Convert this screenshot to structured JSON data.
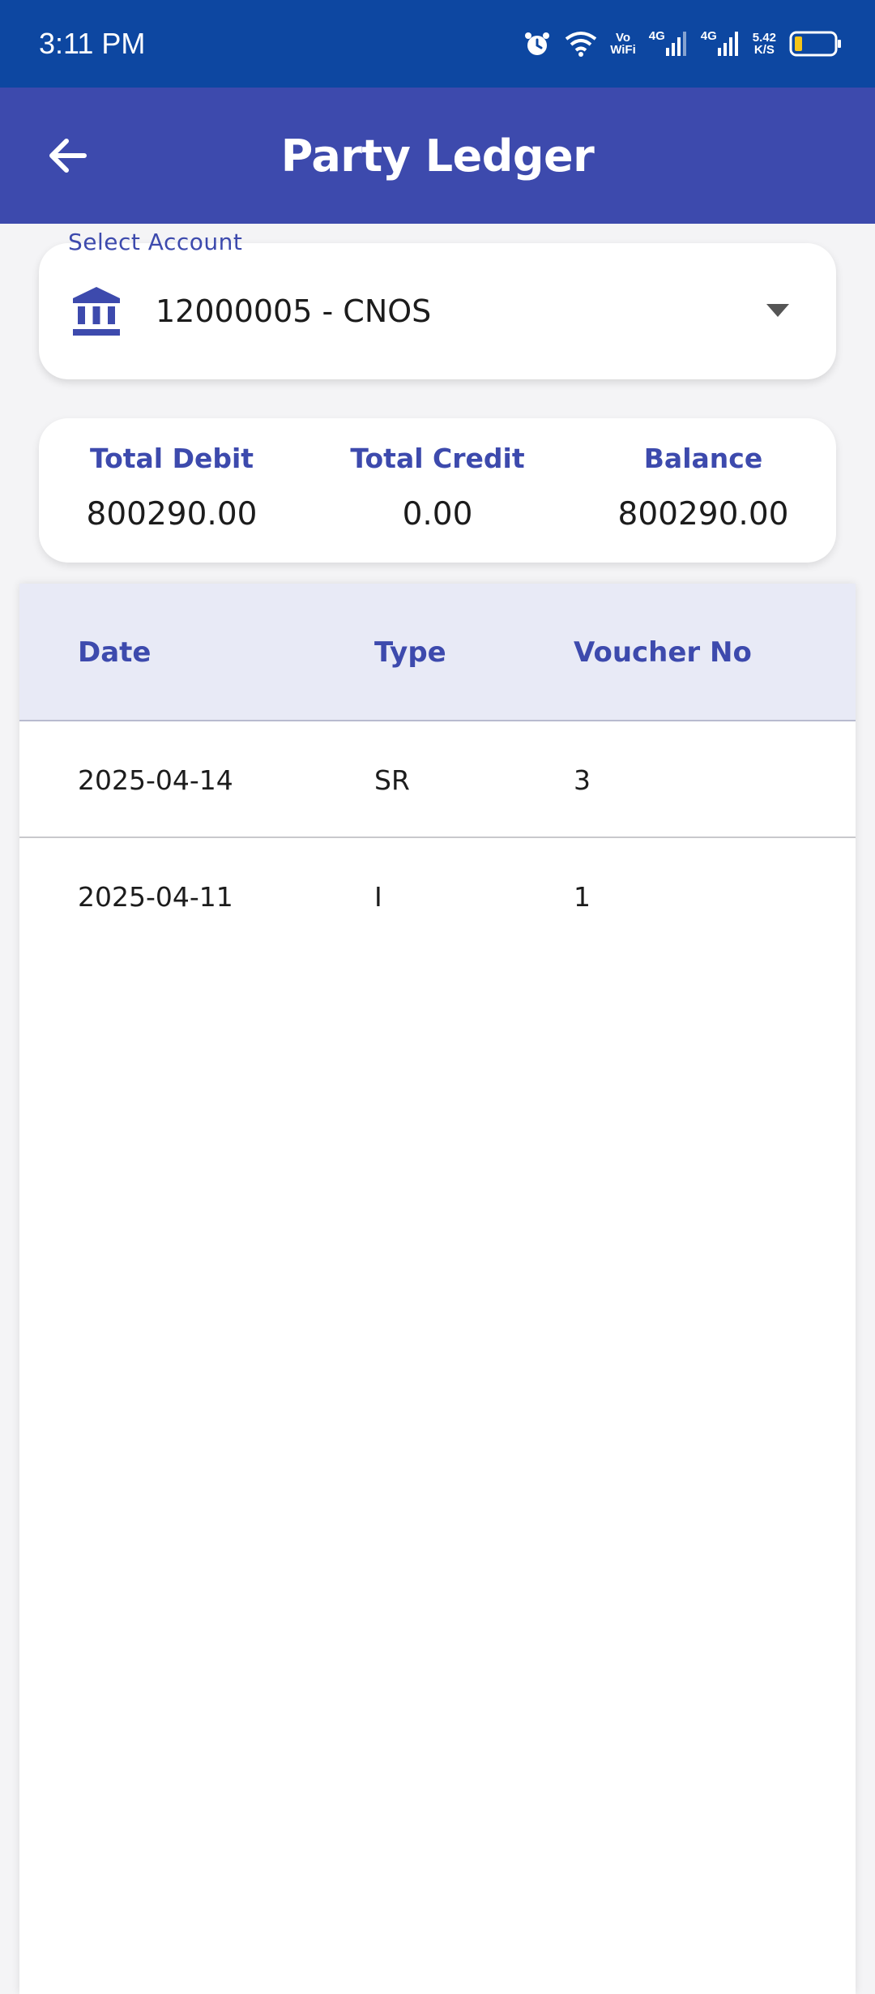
{
  "status_bar": {
    "time": "3:11 PM",
    "volte_top": "Vo",
    "volte_bottom": "WiFi",
    "net1": "4G",
    "net2": "4G",
    "speed_top": "5.42",
    "speed_bottom": "K/S",
    "battery_level": 0.2,
    "icons": [
      "alarm-icon",
      "wifi-icon",
      "signal-icon",
      "signal-icon",
      "battery-icon"
    ]
  },
  "app_bar": {
    "title": "Party Ledger",
    "back_icon": "back-arrow-icon"
  },
  "account": {
    "label": "Select Account",
    "value": "12000005 - CNOS",
    "icon": "bank-icon",
    "dropdown_icon": "chevron-down-icon"
  },
  "summary": {
    "debit_label": "Total Debit",
    "debit_value": "800290.00",
    "credit_label": "Total Credit",
    "credit_value": "0.00",
    "balance_label": "Balance",
    "balance_value": "800290.00"
  },
  "table": {
    "headers": [
      "Date",
      "Type",
      "Voucher No"
    ],
    "rows": [
      {
        "date": "2025-04-14",
        "type": "SR",
        "voucher": "3"
      },
      {
        "date": "2025-04-11",
        "type": "I",
        "voucher": "1"
      }
    ]
  },
  "colors": {
    "status_bar": "#0d47a1",
    "primary": "#3d4aad",
    "header_bg": "#e8eaf6",
    "battery_fill": "#f5c518"
  }
}
